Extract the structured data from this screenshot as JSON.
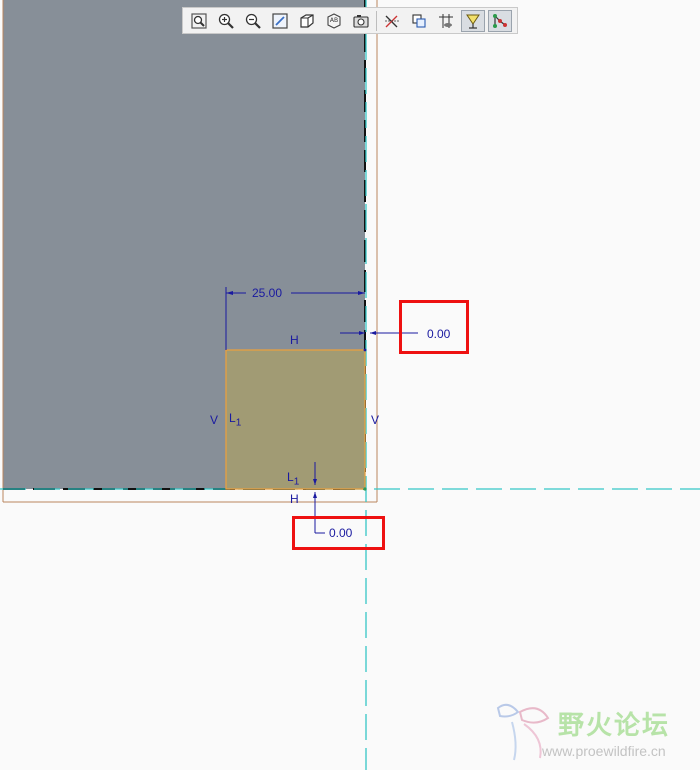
{
  "toolbar": {
    "buttons": [
      {
        "name": "refit-icon"
      },
      {
        "name": "zoom-in-icon"
      },
      {
        "name": "zoom-out-icon"
      },
      {
        "name": "repaint-icon"
      },
      {
        "name": "display-style-icon"
      },
      {
        "name": "saved-views-icon"
      },
      {
        "name": "sketch-view-icon"
      },
      {
        "name": "toggle-dimensions-icon"
      },
      {
        "name": "toggle-constraints-icon"
      },
      {
        "name": "toggle-grid-icon"
      },
      {
        "name": "toggle-vertices-icon"
      },
      {
        "name": "shade-closed-loops-icon"
      }
    ]
  },
  "sketch": {
    "dim_width": "25.00",
    "dim_right_offset": "0.00",
    "dim_bottom_offset": "0.00",
    "constraint_h_top": "H",
    "constraint_h_bottom": "H",
    "constraint_v_left": "V",
    "constraint_v_right": "V",
    "constraint_l1_left": "L",
    "constraint_l1_left_sub": "1",
    "constraint_l1_bottom": "L",
    "constraint_l1_bottom_sub": "1"
  },
  "colors": {
    "part_fill": "#878f98",
    "profile_fill": "#a19b74",
    "profile_edge": "#e8a040",
    "dimension": "#1a1aa0",
    "centerline": "#35c6c6",
    "callout": "#ee1111"
  },
  "watermark": {
    "title": "野火论坛",
    "url": "www.proewildfire.cn"
  }
}
